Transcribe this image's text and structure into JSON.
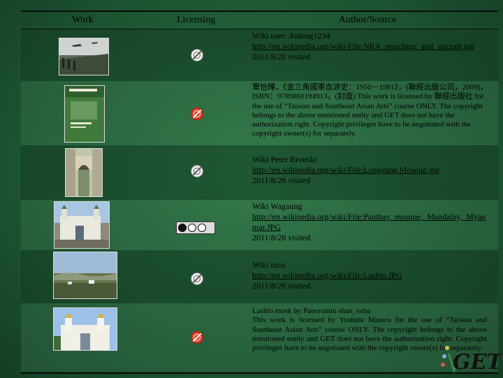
{
  "header": {
    "work": "Work",
    "licensing": "Licensing",
    "author": "Author/Source"
  },
  "rows": [
    {
      "lines": [
        "Wiki user:  Anlang1234",
        "http://en.wikipedia.org/wiki/File:NRA_marching_and_aircraft.jpg",
        "2011/8/28 visited"
      ],
      "license_icon": "no-copyright-icon",
      "thumb": "soldiers-marching-photo"
    },
    {
      "lines": [
        "覃怡輝，《金三角國軍血淚史：1950－1981》，(聯經出版公司，2009)，ISBN：9789860194913，(封面) This work is licensed by 聯經出版社 for the use of “Taiwan and Southeast Asian Arts” course ONLY. The copyright belongs to the above mentioned entity and GET does not have the authorization right. Copyright privileges have to be negotiated with the copyright owner(s) for separately."
      ],
      "license_icon": "restricted-license-icon",
      "thumb": "book-cover-image"
    },
    {
      "lines": [
        "Wiki Peter Bronski",
        "http://en.wikipedia.org/wiki/File:Longgang.Mosque.jpg",
        "2011/8/28 visited"
      ],
      "license_icon": "no-copyright-icon",
      "thumb": "mosque-gate-photo"
    },
    {
      "lines": [
        "Wiki  Wagaung",
        "http://en.wikipedia.org/wiki/File:Panthay_mosque,_Mandalay,_Myanmar.JPG",
        "2011/8/28 visited"
      ],
      "license_icon": "cc-by-sa-icon",
      "thumb": "panthay-mosque-photo"
    },
    {
      "lines": [
        "Wiki nico",
        "http://en.wikipedia.org/wiki/File:Lashio.JPG",
        "2011/8/28 visited"
      ],
      "license_icon": "no-copyright-icon",
      "thumb": "lashio-landscape-photo"
    },
    {
      "lines": [
        "Lashio mosk by Panoramio shan_soba",
        "This work is licensed by Yoshida Minoru for the use of “Taiwan and Southeast Asian Arts” course ONLY. The copyright belongs to the above mentioned entity and GET does not have the authorization right. Copyright privileges have to be negotiated with the copyright owner(s) for separately."
      ],
      "license_icon": "restricted-license-icon",
      "thumb": "lashio-mosque-photo"
    }
  ],
  "logo_text": "GET"
}
